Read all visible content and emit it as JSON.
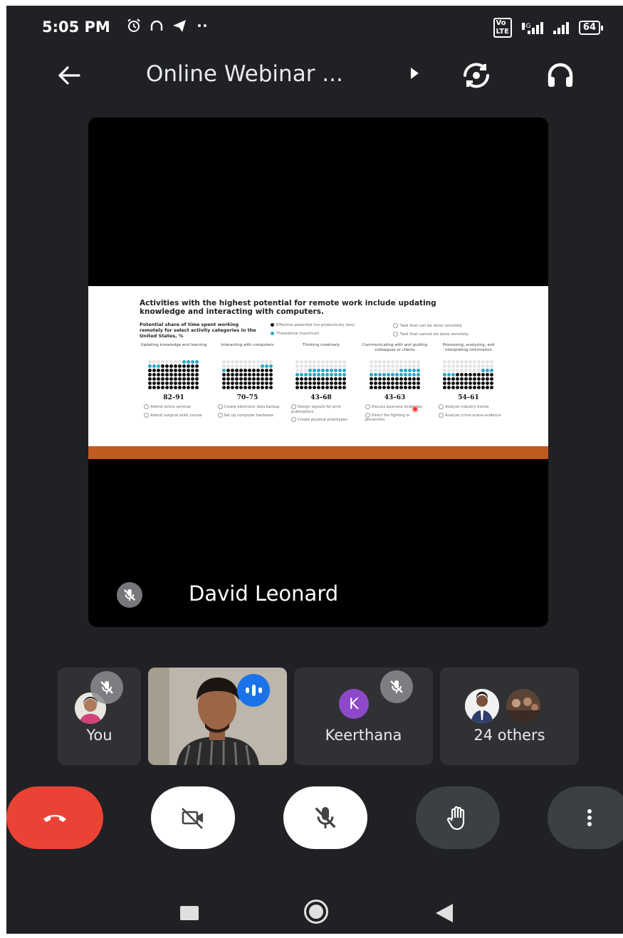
{
  "status_bar": {
    "time": "5:05 PM",
    "left_icons": [
      "alarm-icon",
      "headset-icon",
      "telegram-icon",
      "more-dots-icon"
    ],
    "volte": "Vo\nLTE",
    "network": "4G",
    "battery": "64"
  },
  "header": {
    "title": "Online Webinar ...",
    "icons": [
      "back-arrow-icon",
      "caret-right-icon",
      "switch-camera-icon",
      "headphones-icon"
    ]
  },
  "presentation": {
    "presenter_name": "David Leonard",
    "slide": {
      "title": "Activities with the highest potential for remote work include updating knowledge and interacting with computers.",
      "subtitle": "Potential share of time spent working remotely for select activity categories in the United States, %",
      "legend": [
        {
          "label": "Effective potential (no productivity loss)",
          "color": "#111111"
        },
        {
          "label": "Theoretical maximum",
          "color": "#2aa6c8"
        },
        {
          "label": "Task that can be done remotely",
          "color": "#ffffff"
        },
        {
          "label": "Task that cannot be done remotely",
          "color": "#ffffff"
        }
      ],
      "columns": [
        {
          "header": "Updating knowledge and learning",
          "range": "82–91",
          "effective": 82,
          "max": 91,
          "examples": [
            "Attend online seminar",
            "Attend surgical skills course"
          ]
        },
        {
          "header": "Interacting with computers",
          "range": "70–75",
          "effective": 70,
          "max": 75,
          "examples": [
            "Create electronic data backup",
            "Set up computer hardware"
          ]
        },
        {
          "header": "Thinking creatively",
          "range": "43–68",
          "effective": 43,
          "max": 68,
          "examples": [
            "Design layouts for print publications",
            "Create physical prototypes"
          ]
        },
        {
          "header": "Communicating with and guiding colleagues or clients",
          "range": "43–63",
          "effective": 43,
          "max": 63,
          "examples": [
            "Discuss business strategies",
            "Direct fire fighting or prevention"
          ]
        },
        {
          "header": "Processing, analyzing, and interpreting information",
          "range": "54–61",
          "effective": 54,
          "max": 61,
          "examples": [
            "Analyze industry trends",
            "Analyze crime scene evidence"
          ]
        }
      ],
      "accent_color": "#c15a1e"
    }
  },
  "participants": [
    {
      "label": "You",
      "muted": true
    },
    {
      "label": "",
      "speaking": true
    },
    {
      "label": "Keerthana",
      "initial": "K",
      "muted": true,
      "avatar_color": "#8e49c9"
    },
    {
      "label": "24 others"
    }
  ],
  "controls": {
    "end_call": "end-call-icon",
    "camera": "camera-off-icon",
    "mic": "mic-off-icon",
    "raise_hand": "raise-hand-icon",
    "more": "more-vertical-icon",
    "end_color": "#ea4335"
  },
  "nav_bar": [
    "recents-icon",
    "home-icon",
    "back-icon"
  ]
}
